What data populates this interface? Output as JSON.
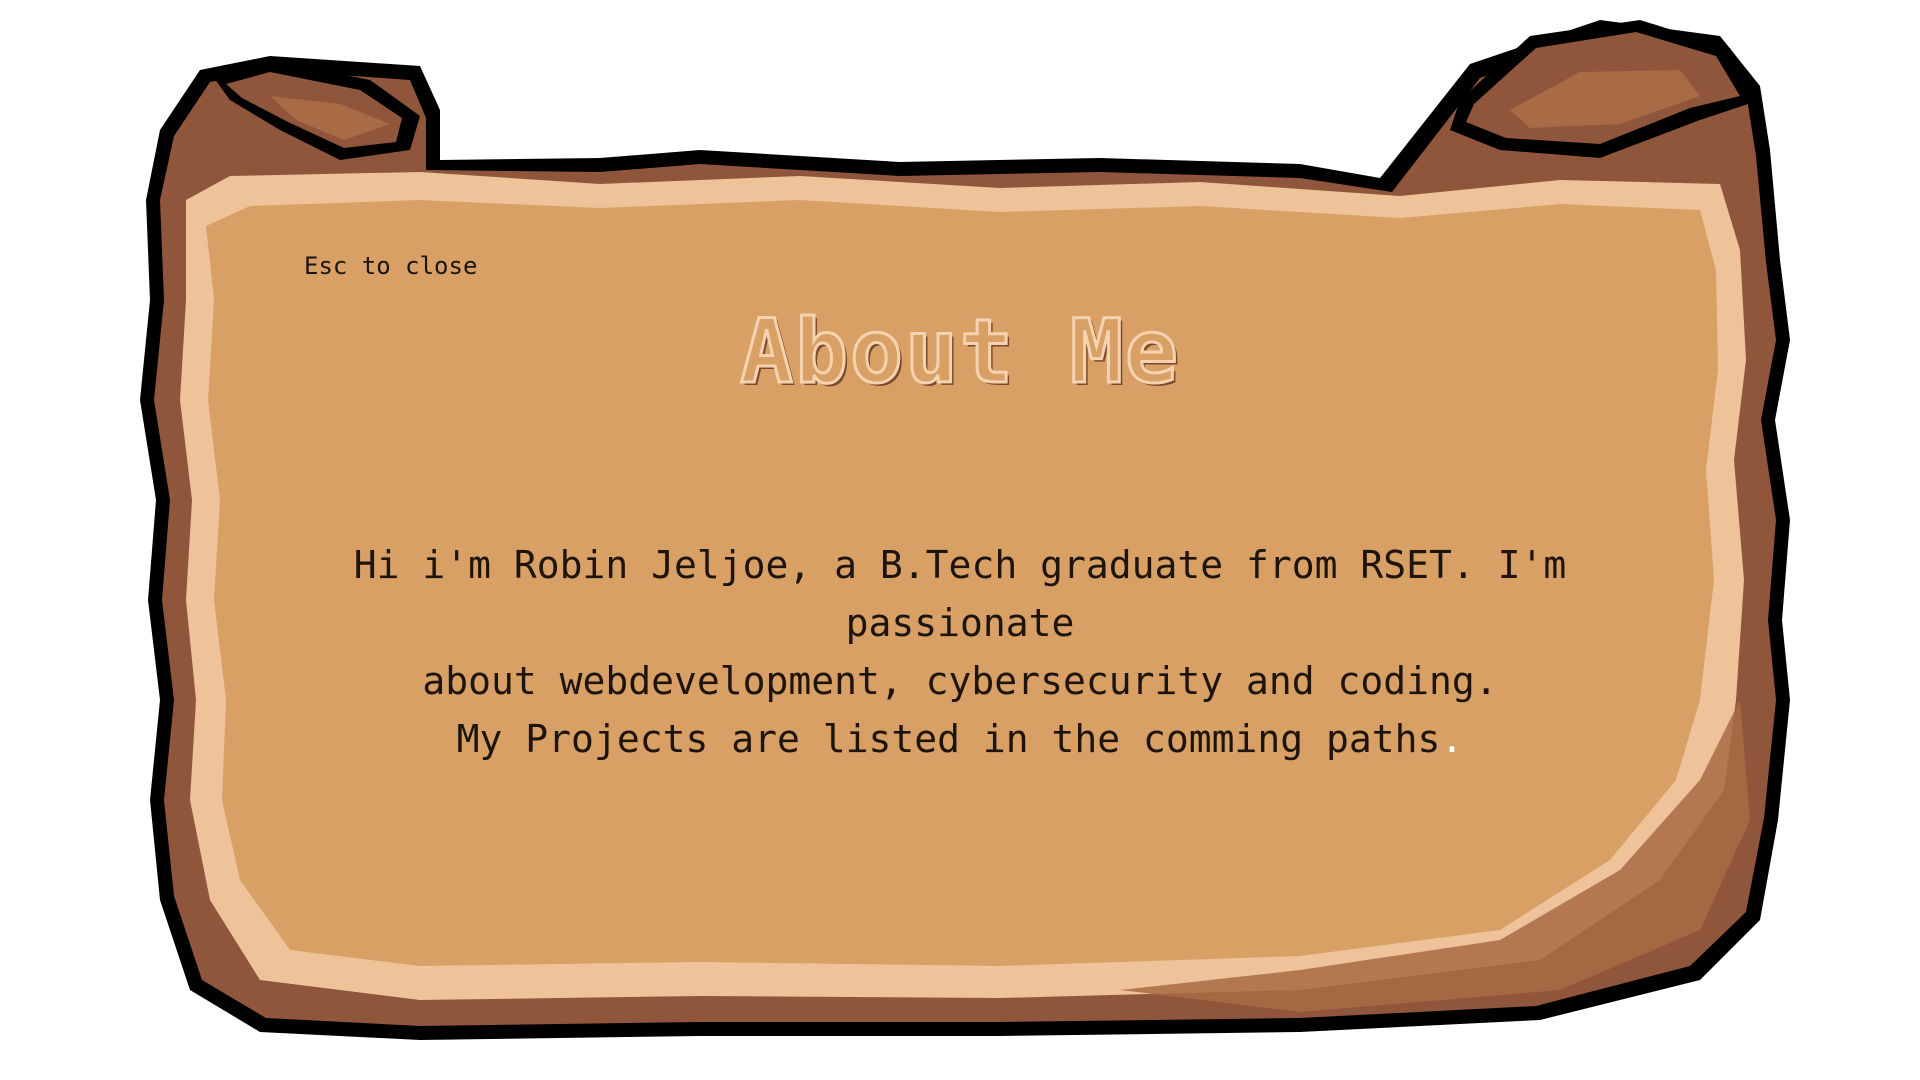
{
  "dialog": {
    "close_hint": "Esc to close",
    "title": "About Me",
    "body_lines": [
      "Hi i'm Robin Jeljoe, a B.Tech graduate from RSET. I'm passionate",
      "about webdevelopment, cybersecurity and coding.",
      "My Projects are listed in the comming paths"
    ],
    "trailing_period": "."
  },
  "colors": {
    "parchment": "#d9a066",
    "parchment_highlight": "#eec39a",
    "scroll_dark": "#8f563b",
    "scroll_mid": "#a86b45",
    "outline": "#000000",
    "title_fill": "#d9a066",
    "text": "#1d140c"
  },
  "icons": {
    "scroll": "parchment-scroll"
  }
}
